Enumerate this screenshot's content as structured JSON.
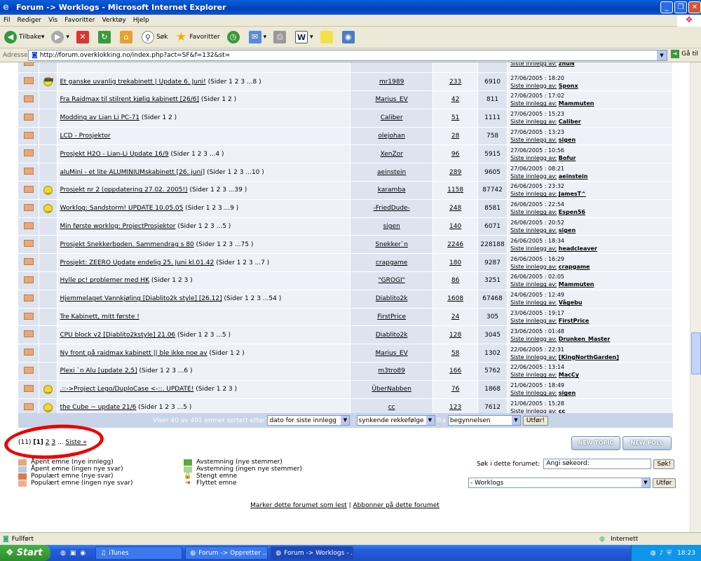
{
  "window": {
    "title": "Forum -> Worklogs - Microsoft Internet Explorer"
  },
  "menu": [
    "Fil",
    "Rediger",
    "Vis",
    "Favoritter",
    "Verktøy",
    "Hjelp"
  ],
  "toolbar": {
    "back": "Tilbake",
    "search": "Søk",
    "favorites": "Favoritter"
  },
  "address": {
    "label": "Adresse",
    "url": "http://forum.overklokking.no/index.php?act=SF&f=132&st=",
    "go": "Gå til"
  },
  "topics": [
    {
      "icon": "env",
      "smiley": false,
      "title": "",
      "pages": "",
      "starter": "",
      "replies": "",
      "views": "",
      "date": "",
      "last_label": "Siste innlegg av:",
      "last_user": "zhuN"
    },
    {
      "icon": "env",
      "smiley": "cool",
      "title": "Et ganske uvanlig trekabinett | Update 6. Juni!",
      "pages": "(Sider 1 2 3 ...8 )",
      "starter": "mr1989",
      "replies": "233",
      "views": "6910",
      "date": "27/06/2005 : 18:20",
      "last_label": "Siste innlegg av:",
      "last_user": "Sponx"
    },
    {
      "icon": "env",
      "smiley": false,
      "title": "Fra Raidmax til stilrent kjølig kabinett [26/6]",
      "pages": "(Sider 1 2 )",
      "starter": "Marius_EV",
      "replies": "42",
      "views": "811",
      "date": "27/06/2005 : 17:02",
      "last_label": "Siste innlegg av:",
      "last_user": "Mammuten"
    },
    {
      "icon": "env",
      "smiley": false,
      "title": "Modding av Lian Li PC-71",
      "pages": "(Sider 1 2 )",
      "starter": "Caliber",
      "replies": "51",
      "views": "1111",
      "date": "27/06/2005 : 15:23",
      "last_label": "Siste innlegg av:",
      "last_user": "Caliber"
    },
    {
      "icon": "env",
      "smiley": false,
      "title": "LCD - Prosjektor",
      "pages": "",
      "starter": "olejohan",
      "replies": "28",
      "views": "758",
      "date": "27/06/2005 : 13:23",
      "last_label": "Siste innlegg av:",
      "last_user": "sigen"
    },
    {
      "icon": "env",
      "smiley": false,
      "title": "Prosjekt H2O - Lian-Li Update 16/9",
      "pages": "(Sider 1 2 3 ...4 )",
      "starter": "XenZor",
      "replies": "96",
      "views": "5915",
      "date": "27/06/2005 : 10:56",
      "last_label": "Siste innlegg av:",
      "last_user": "Bofur"
    },
    {
      "icon": "env",
      "smiley": false,
      "title": "aluMini - et lite ALUMINIUMskabinett [26. juni]",
      "pages": "(Sider 1 2 3 ...10 )",
      "starter": "aeinstein",
      "replies": "289",
      "views": "9605",
      "date": "27/06/2005 : 08:21",
      "last_label": "Siste innlegg av:",
      "last_user": "aeinstein"
    },
    {
      "icon": "env",
      "smiley": "smile",
      "title": "Prosjekt nr 2 (oppdatering 27.02. 2005!)",
      "pages": "(Sider 1 2 3 ...39 )",
      "starter": "karamba",
      "replies": "1158",
      "views": "87742",
      "date": "26/06/2005 : 23:32",
      "last_label": "Siste innlegg av:",
      "last_user": "JamesT^"
    },
    {
      "icon": "env",
      "smiley": "smile",
      "title": "Worklog: Sandstorm! UPDATE 10.05.05",
      "pages": "(Sider 1 2 3 ...9 )",
      "starter": "-FriedDude-",
      "replies": "248",
      "views": "8581",
      "date": "26/06/2005 : 22:54",
      "last_label": "Siste innlegg av:",
      "last_user": "Espen56"
    },
    {
      "icon": "env",
      "smiley": false,
      "title": "Min første worklog: ProjectProsjektor",
      "pages": "(Sider 1 2 3 ...5 )",
      "starter": "sigen",
      "replies": "140",
      "views": "6071",
      "date": "26/06/2005 : 20:52",
      "last_label": "Siste innlegg av:",
      "last_user": "sigen"
    },
    {
      "icon": "env",
      "smiley": false,
      "title": "Prosjekt Snekkerboden. Sammendrag s 80",
      "pages": "(Sider 1 2 3 ...75 )",
      "starter": "Snekker`n",
      "replies": "2246",
      "views": "228188",
      "date": "26/06/2005 : 18:34",
      "last_label": "Siste innlegg av:",
      "last_user": "headcleaver"
    },
    {
      "icon": "env",
      "smiley": false,
      "title": "Prosjekt: ZEERO Update endelig 25. Juni kl.01.42",
      "pages": "(Sider 1 2 3 ...7 )",
      "starter": "crapgame",
      "replies": "180",
      "views": "9287",
      "date": "26/06/2005 : 16:29",
      "last_label": "Siste innlegg av:",
      "last_user": "crapgame"
    },
    {
      "icon": "env",
      "smiley": false,
      "title": "Hylle pc! problemer med HK",
      "pages": "(Sider 1 2 3 )",
      "starter": "\"GROGI\"",
      "replies": "86",
      "views": "3251",
      "date": "26/06/2005 : 02:05",
      "last_label": "Siste innlegg av:",
      "last_user": "Mammuten"
    },
    {
      "icon": "env",
      "smiley": false,
      "title": "Hjemmelaget Vannkjøling [Diablito2k style] [26.12]",
      "pages": "(Sider 1 2 3 ...54 )",
      "starter": "Diablito2k",
      "replies": "1608",
      "views": "67468",
      "date": "24/06/2005 : 12:49",
      "last_label": "Siste innlegg av:",
      "last_user": "Vågebu"
    },
    {
      "icon": "env",
      "smiley": false,
      "title": "Tre Kabinett, mitt første !",
      "pages": "",
      "starter": "FirstPrice",
      "replies": "24",
      "views": "305",
      "date": "23/06/2005 : 19:17",
      "last_label": "Siste innlegg av:",
      "last_user": "FirstPrice"
    },
    {
      "icon": "env",
      "smiley": false,
      "title": "CPU block v2 [Diablito2kstyle] 21.06",
      "pages": "(Sider 1 2 3 ...5 )",
      "starter": "Diablito2k",
      "replies": "128",
      "views": "3045",
      "date": "23/06/2005 : 01:48",
      "last_label": "Siste innlegg av:",
      "last_user": "Drunken_Master"
    },
    {
      "icon": "env",
      "smiley": false,
      "title": "Ny front på raidmax kabinett || ble ikke noe av",
      "pages": "(Sider 1 2 )",
      "starter": "Marius_EV",
      "replies": "58",
      "views": "1302",
      "date": "22/06/2005 : 22:31",
      "last_label": "Siste innlegg av:",
      "last_user": "[KingNorthGarden]"
    },
    {
      "icon": "env",
      "smiley": false,
      "title": "Plexi `n Alu [update 2,5]",
      "pages": "(Sider 1 2 3 ...6 )",
      "starter": "m3tro89",
      "replies": "166",
      "views": "5762",
      "date": "22/06/2005 : 13:14",
      "last_label": "Siste innlegg av:",
      "last_user": "MacCy"
    },
    {
      "icon": "env",
      "smiley": "smile",
      "title": ".::->Project Lego/DuploCase <-::. UPDATE!",
      "pages": "(Sider 1 2 3 )",
      "starter": "ÜberNabben",
      "replies": "76",
      "views": "1868",
      "date": "21/06/2005 : 18:49",
      "last_label": "Siste innlegg av:",
      "last_user": "sigen"
    },
    {
      "icon": "env",
      "smiley": "smile",
      "title": "the Cube ~ update 21/6",
      "pages": "(Sider 1 2 3 ...5 )",
      "starter": "cc",
      "replies": "123",
      "views": "7612",
      "date": "21/06/2005 : 15:28",
      "last_label": "Siste innlegg av:",
      "last_user": "cc"
    }
  ],
  "sortbar": {
    "text": "Viser 40 av 401 emner sortert etter",
    "sort_by": "dato for siste innlegg",
    "order": "synkende rekkefølge",
    "from_label": "fra",
    "from": "begynnelsen",
    "submit": "Utfør!"
  },
  "pager": {
    "count": "(11)",
    "current": "[1]",
    "p2": "2",
    "p3": "3",
    "dots": "...",
    "last": "Siste »"
  },
  "buttons": {
    "new_topic": "NEW TOPIC",
    "new_poll": "NEW POLL"
  },
  "legend_left": [
    "Åpent emne (nye innlegg)",
    "Åpent emne (ingen nye svar)",
    "Populært emne (nye svar)",
    "Populært emne (ingen nye svar)"
  ],
  "legend_right": [
    "Avstemning (nye stemmer)",
    "Avstemning (ingen nye stemmer)",
    "Stengt emne",
    "Flyttet emne"
  ],
  "search": {
    "label": "Søk i dette forumet:",
    "placeholder": "Angi søkeord:",
    "button": "Søk!"
  },
  "jump": {
    "value": "- Worklogs",
    "button": "Utfør"
  },
  "footer": {
    "mark_read": "Marker dette forumet som lest",
    "sep": "|",
    "subscribe": "Abbonner på dette forumet"
  },
  "status": {
    "left": "Fullført",
    "zone": "Internett"
  },
  "taskbar": {
    "start": "Start",
    "tasks": [
      "iTunes",
      "Forum -> Oppretter ...",
      "Forum -> Worklogs - ..."
    ],
    "clock": "18:23"
  },
  "colors": {
    "title_blue": "#0340b8",
    "row_dark": "#dde4ef",
    "row_light": "#eef2f8",
    "sort_bar": "#c8d4e8",
    "highlight": "#e00000"
  }
}
